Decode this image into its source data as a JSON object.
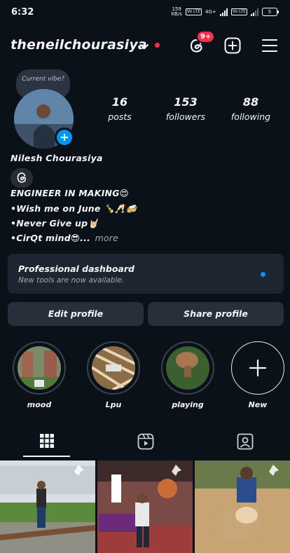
{
  "status_bar": {
    "time": "6:32",
    "net_speed": "159",
    "net_unit": "KB/s",
    "volte": "Vo LTE",
    "network": "4G+",
    "network2": "4G",
    "battery": "5"
  },
  "header": {
    "username": "theneilchourasiya",
    "notification_count": "9+"
  },
  "profile": {
    "note": "Current vibe?",
    "stats": [
      {
        "value": "16",
        "label": "posts"
      },
      {
        "value": "153",
        "label": "followers"
      },
      {
        "value": "88",
        "label": "following"
      }
    ],
    "full_name": "Nilesh Chourasiya",
    "bio": [
      "ENGINEER IN MAKING😍",
      "•Wish me on June 🍾🥂🍻",
      "•Never Give up🤘🏻",
      "•CirQt mind😎..."
    ],
    "more": "more"
  },
  "dashboard": {
    "title": "Professional dashboard",
    "subtitle": "New tools are now available."
  },
  "buttons": {
    "edit": "Edit profile",
    "share": "Share profile"
  },
  "highlights": [
    {
      "label": "mood"
    },
    {
      "label": "Lpu"
    },
    {
      "label": "playing"
    },
    {
      "label": "New"
    }
  ],
  "tabs": [
    "grid-icon",
    "reels-icon",
    "tagged-icon"
  ],
  "colors": {
    "background": "#0b1119",
    "accent": "#0095f6",
    "badge": "#ff2d4a"
  }
}
